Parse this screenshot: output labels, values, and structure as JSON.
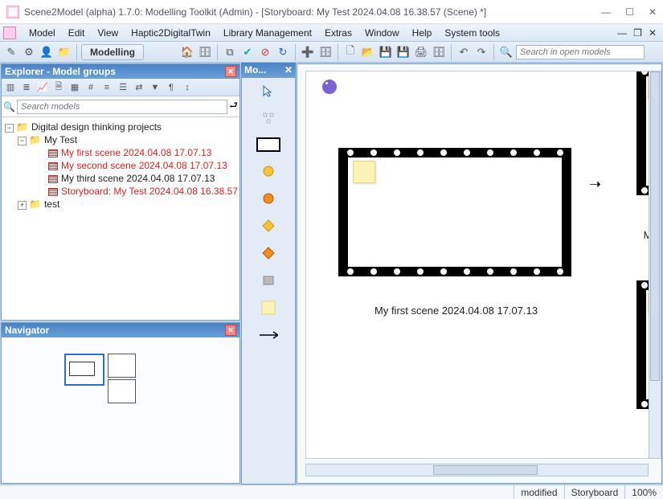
{
  "window": {
    "title": "Scene2Model (alpha) 1.7.0: Modelling Toolkit (Admin) - [Storyboard: My Test 2024.04.08 16.38.57 (Scene) *]"
  },
  "menu": {
    "items": [
      "Model",
      "Edit",
      "View",
      "Haptic2DigitalTwin",
      "Library Management",
      "Extras",
      "Window",
      "Help",
      "System tools"
    ]
  },
  "toolbar": {
    "mode_label": "Modelling",
    "search_placeholder": "Search in open models"
  },
  "explorer": {
    "title": "Explorer - Model groups",
    "search_placeholder": "Search models",
    "root": "Digital design thinking projects",
    "node_mytest": "My Test",
    "node_test": "test",
    "items": [
      {
        "label": "My first scene 2024.04.08 17.07.13",
        "red": true
      },
      {
        "label": "My second scene 2024.04.08 17.07.13",
        "red": true
      },
      {
        "label": "My third scene 2024.04.08 17.07.13",
        "red": false
      },
      {
        "label": "Storyboard: My Test 2024.04.08 16.38.57",
        "red": true
      }
    ]
  },
  "navigator": {
    "title": "Navigator"
  },
  "model_toolbar": {
    "title": "Mo..."
  },
  "canvas": {
    "frame1_caption": "My first scene 2024.04.08 17.07.13",
    "frame3_caption_partial": "My"
  },
  "status": {
    "modified": "modified",
    "mode": "Storyboard",
    "zoom": "100%"
  },
  "colors": {
    "accent": "#4a82c4",
    "red": "#d22"
  }
}
